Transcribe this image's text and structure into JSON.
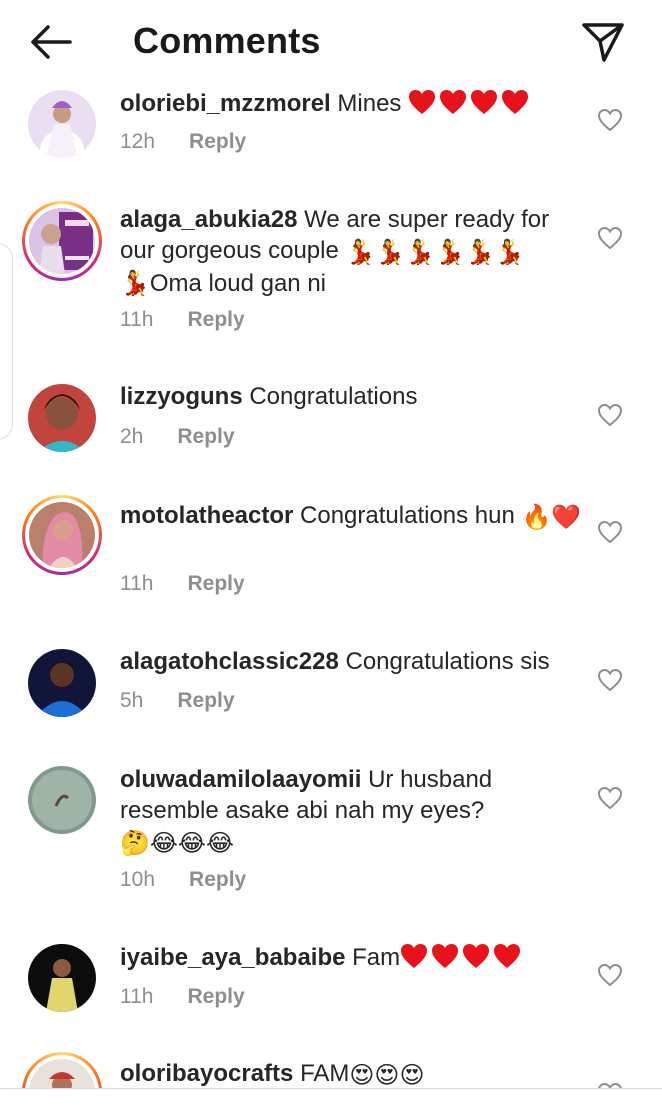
{
  "header": {
    "title": "Comments",
    "back_icon": "arrow-left-icon",
    "share_icon": "paper-plane-icon"
  },
  "reply_label": "Reply",
  "comments": [
    {
      "username": "oloriebi_mzzmorel",
      "text": "Mines",
      "emoji_after": "❤️❤️❤️❤️",
      "time": "12h"
    },
    {
      "username": "alaga_abukia28",
      "text": "We are super ready for our gorgeous couple",
      "emoji_after": "💃💃💃💃💃💃",
      "text2": "💃Oma loud gan ni",
      "time": "11h"
    },
    {
      "username": "lizzyoguns",
      "text": "Congratulations",
      "time": "2h"
    },
    {
      "username": "motolatheactor",
      "text": "Congratulations hun",
      "emoji_after": "🔥❤️",
      "time": "11h"
    },
    {
      "username": "alagatohclassic228",
      "text": "Congratulations sis",
      "time": "5h"
    },
    {
      "username": "oluwadamilolaayomii",
      "text": "Ur husband resemble asake abi nah my eyes?",
      "emoji_after": "🤔😂😂😂",
      "time": "10h"
    },
    {
      "username": "iyaibe_aya_babaibe",
      "text": "Fam",
      "emoji_after": "❤️❤️❤️❤️",
      "time": "11h"
    },
    {
      "username": "oloribayocrafts",
      "text": "FAM",
      "emoji_after": "😍😍😍",
      "time": ""
    }
  ],
  "colors": {
    "text": "#262626",
    "meta": "#8e8e8e",
    "heart": "#e8121b"
  }
}
